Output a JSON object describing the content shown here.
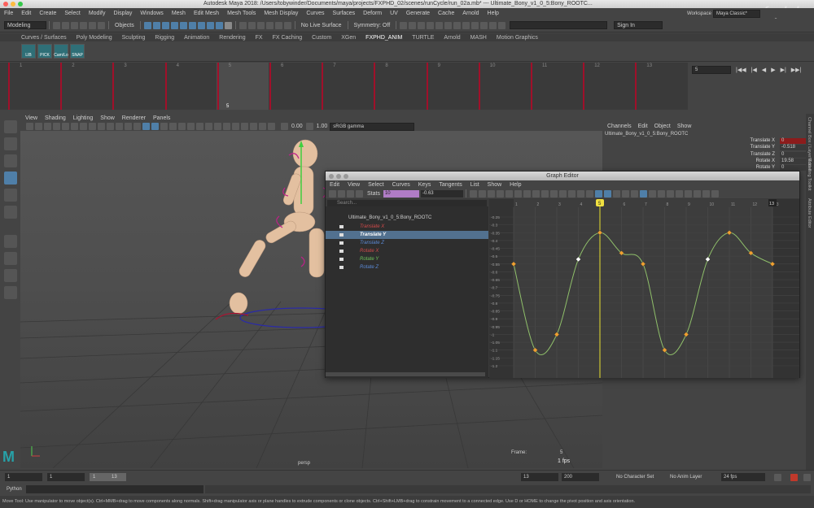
{
  "window": {
    "title": "Autodesk Maya 2018: /Users/tobywinder/Documents/maya/projects/FXPHD_02/scenes/runCycle/run_02a.mb*  ---  Ultimate_Bony_v1_0_5:Bony_ROOTC...",
    "watermark": "fxphd"
  },
  "menubar": [
    "File",
    "Edit",
    "Create",
    "Select",
    "Modify",
    "Display",
    "Windows",
    "Mesh",
    "Edit Mesh",
    "Mesh Tools",
    "Mesh Display",
    "Curves",
    "Surfaces",
    "Deform",
    "UV",
    "Generate",
    "Cache",
    "Arnold",
    "Help"
  ],
  "status": {
    "mode": "Modeling",
    "objects": "Objects",
    "live_surface": "No Live Surface",
    "symmetry": "Symmetry: Off",
    "sign_in": "Sign In",
    "workspace_label": "Workspace",
    "workspace": "Maya Classic*"
  },
  "shelf_tabs": [
    "Curves / Surfaces",
    "Poly Modeling",
    "Sculpting",
    "Rigging",
    "Animation",
    "Rendering",
    "FX",
    "FX Caching",
    "Custom",
    "XGen",
    "FXPHD_ANIM",
    "TURTLE",
    "Arnold",
    "MASH",
    "Motion Graphics"
  ],
  "shelf_active": "FXPHD_ANIM",
  "shelf_buttons": [
    "LIB",
    "PICK",
    "Cam/Lo",
    "SNAP"
  ],
  "timeline": {
    "ticks": [
      "1",
      "2",
      "3",
      "4",
      "5",
      "6",
      "7",
      "8",
      "9",
      "10",
      "11",
      "12",
      "13"
    ],
    "current_label": "5",
    "current_frame": "5"
  },
  "viewport": {
    "menu": [
      "View",
      "Shading",
      "Lighting",
      "Show",
      "Renderer",
      "Panels"
    ],
    "exposure": "0.00",
    "gamma": "1.00",
    "colorspace": "sRGB gamma",
    "camera": "persp",
    "frame_label": "Frame:",
    "frame_value": "5",
    "fps": "1 fps"
  },
  "channel_box": {
    "menu": [
      "Channels",
      "Edit",
      "Object",
      "Show"
    ],
    "node": "Ultimate_Bony_v1_0_5:Bony_ROOTC",
    "attrs": [
      {
        "name": "Translate X",
        "value": "0"
      },
      {
        "name": "Translate Y",
        "value": "-0.518"
      },
      {
        "name": "Translate Z",
        "value": "0"
      },
      {
        "name": "Rotate X",
        "value": "19.58"
      },
      {
        "name": "Rotate Y",
        "value": "0"
      }
    ],
    "side_tabs": [
      "Channel Box / Layer Editor",
      "Modelling Toolkit",
      "Attribute Editor"
    ]
  },
  "graph_editor": {
    "title": "Graph Editor",
    "menu": [
      "Edit",
      "View",
      "Select",
      "Curves",
      "Keys",
      "Tangents",
      "List",
      "Show",
      "Help"
    ],
    "stats_label": "Stats",
    "stats_frame": "10",
    "stats_value": "-0.63",
    "search_placeholder": "Search...",
    "root": "Ultimate_Bony_v1_0_5:Bony_ROOTC",
    "channels": [
      {
        "name": "Translate X",
        "color": "#d14a4a"
      },
      {
        "name": "Translate Y",
        "color": "#ffffff",
        "selected": true
      },
      {
        "name": "Translate Z",
        "color": "#5b8ad6"
      },
      {
        "name": "Rotate X",
        "color": "#d14a4a"
      },
      {
        "name": "Rotate Y",
        "color": "#6cc35a"
      },
      {
        "name": "Rotate Z",
        "color": "#5b8ad6"
      }
    ],
    "x_ticks": [
      "1",
      "2",
      "3",
      "4",
      "5",
      "6",
      "7",
      "8",
      "9",
      "10",
      "11",
      "12",
      "13"
    ],
    "y_ticks": [
      "-0.25",
      "-0.3",
      "-0.35",
      "-0.4",
      "-0.45",
      "-0.5",
      "-0.55",
      "-0.6",
      "-0.65",
      "-0.7",
      "-0.75",
      "-0.8",
      "-0.85",
      "-0.9",
      "-0.95",
      "-1",
      "-1.05",
      "-1.1",
      "-1.15",
      "-1.2"
    ],
    "current_frame": "5",
    "end_frame": "13",
    "curve_color": "#8fbf6a",
    "key_color": "#f0a030",
    "keys": [
      {
        "frame": 1,
        "value": -0.55
      },
      {
        "frame": 2,
        "value": -1.1
      },
      {
        "frame": 3,
        "value": -1.0
      },
      {
        "frame": 4,
        "value": -0.52,
        "selected": true
      },
      {
        "frame": 5,
        "value": -0.35
      },
      {
        "frame": 6,
        "value": -0.48
      },
      {
        "frame": 7,
        "value": -0.55
      },
      {
        "frame": 8,
        "value": -1.1
      },
      {
        "frame": 9,
        "value": -1.0
      },
      {
        "frame": 10,
        "value": -0.52,
        "selected": true
      },
      {
        "frame": 11,
        "value": -0.35
      },
      {
        "frame": 12,
        "value": -0.48
      },
      {
        "frame": 13,
        "value": -0.55
      }
    ]
  },
  "range": {
    "start": "1",
    "anim_start": "1",
    "slider_start": "1",
    "slider_end": "13",
    "anim_end": "13",
    "end": "200",
    "character_set": "No Character Set",
    "anim_layer": "No Anim Layer",
    "fps": "24 fps"
  },
  "command": {
    "label": "Python"
  },
  "help": "Move Tool: Use manipulator to move object(s). Ctrl+MMB+drag to move components along normals. Shift+drag manipulator axis or plane handles to extrude components or clone objects. Ctrl+Shift+LMB+drag to constrain movement to a connected edge. Use D or HOME to change the pivot position and axis orientation."
}
